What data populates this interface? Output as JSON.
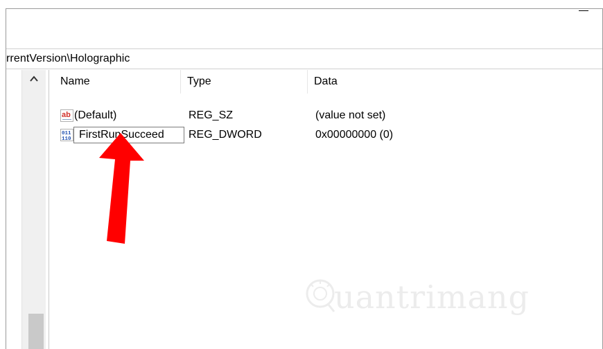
{
  "window": {
    "address_path": "rrentVersion\\Holographic"
  },
  "tree_pane": {
    "scroll_up_glyph": "^"
  },
  "list": {
    "columns": {
      "name": "Name",
      "type": "Type",
      "data": "Data"
    },
    "rows": [
      {
        "icon": "string-value-icon",
        "icon_text": "ab",
        "name": "(Default)",
        "type": "REG_SZ",
        "data": "(value not set)"
      },
      {
        "icon": "binary-value-icon",
        "icon_text": "011\n110",
        "name": "FirstRunSucceed",
        "type": "REG_DWORD",
        "data": "0x00000000 (0)",
        "editing": true
      }
    ]
  },
  "annotation": {
    "arrow_color": "#ff0000"
  },
  "watermark": {
    "text": "uantrimang"
  }
}
